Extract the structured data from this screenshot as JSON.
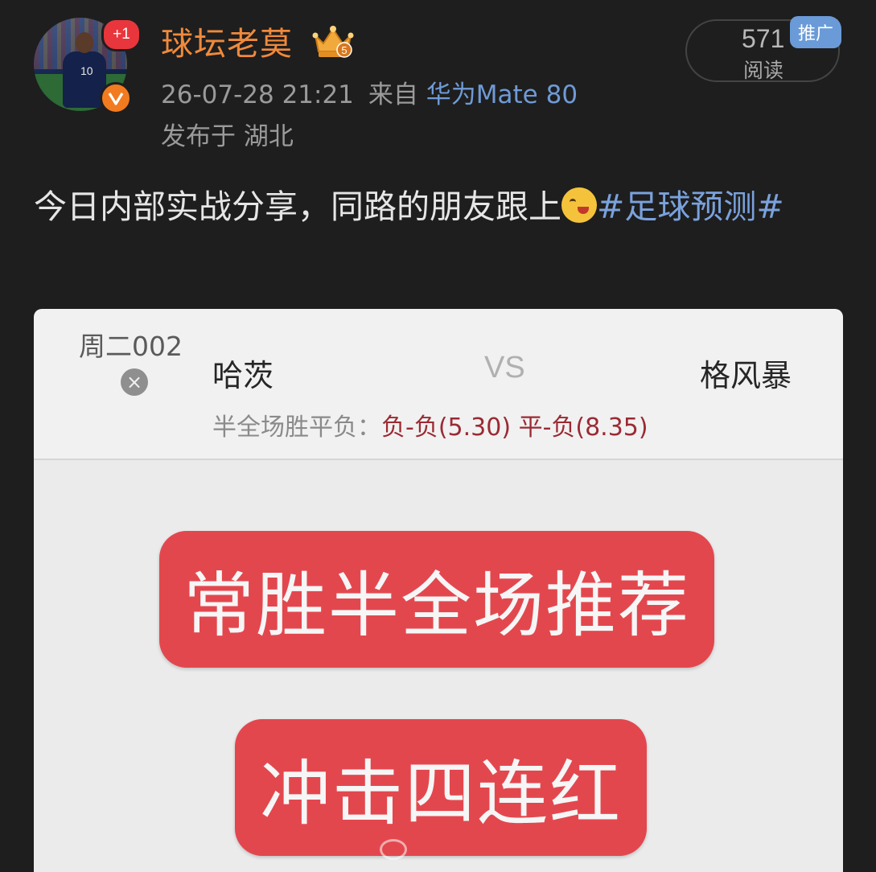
{
  "post": {
    "user": {
      "name": "球坛老莫",
      "avatar_badge": "+1",
      "verified_icon": "verified-v-icon",
      "rank_badge": "5",
      "rank_icon": "crown-icon"
    },
    "timestamp": "26-07-28 21:21",
    "from_label": "来自",
    "device": "华为Mate 80",
    "location": "发布于 湖北",
    "reads": {
      "count": "571",
      "label": "阅读"
    },
    "promo_tag": "推广",
    "text": {
      "main": "今日内部实战分享，同路的朋友跟上",
      "emoji": "drooling-face-emoji",
      "topic": "#足球预测#"
    }
  },
  "card": {
    "match_id": "周二002",
    "close_icon": "×",
    "home_team": "哈茨",
    "vs": "VS",
    "away_team": "格风暴",
    "bet_label": "半全场胜平负：",
    "bet_picks": "负-负(5.30) 平-负(8.35)",
    "banner_1": "常胜半全场推荐",
    "banner_2": "冲击四连红"
  },
  "colors": {
    "background": "#1e1e1e",
    "username": "#f08a3c",
    "topic_link": "#7aa2dc",
    "promo_tag": "#6a9bd8",
    "banner_red": "#e3474e",
    "pick_red": "#9b2a33"
  }
}
